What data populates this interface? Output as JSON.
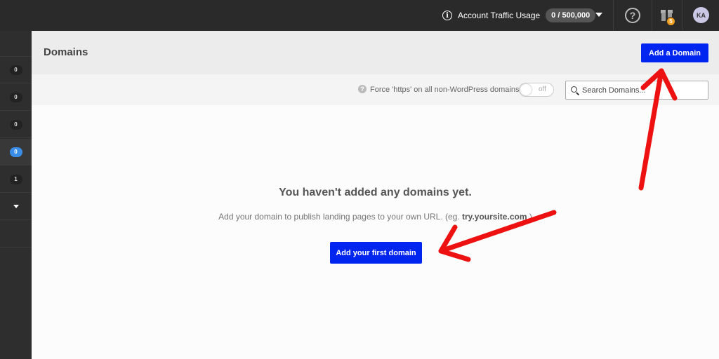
{
  "topbar": {
    "traffic_label": "Account Traffic Usage",
    "traffic_value": "0 / 500,000",
    "notification_count": "5",
    "avatar_initials": "KA",
    "help_glyph": "?",
    "info_glyph": "i",
    "icons": [
      "info-icon",
      "chevron-down-icon",
      "help-icon",
      "gift-icon",
      "avatar"
    ]
  },
  "sidebar": {
    "items": [
      {
        "count": "0",
        "active": false
      },
      {
        "count": "0",
        "active": false
      },
      {
        "count": "0",
        "active": false
      },
      {
        "count": "0",
        "active": true
      },
      {
        "count": "1",
        "active": false
      }
    ],
    "more_icon": "chevron-down-icon"
  },
  "header": {
    "title": "Domains",
    "add_domain_label": "Add a Domain"
  },
  "toolbar": {
    "help_glyph": "?",
    "force_https_label": "Force 'https' on all non-WordPress domains",
    "toggle_state": "off",
    "search_placeholder": "Search Domains..."
  },
  "empty_state": {
    "title": "You haven't added any domains yet.",
    "description_prefix": "Add your domain to publish landing pages to your own URL. (eg. ",
    "description_example": "try.yoursite.com",
    "description_suffix": " )",
    "cta_label": "Add your first domain"
  },
  "colors": {
    "primary": "#0025f0",
    "topbar": "#2a2a2a",
    "sidebar": "#2e2e2e",
    "active_badge": "#3b8ee8",
    "notification_badge": "#f0a020",
    "annotation_arrow": "#ee1111"
  }
}
